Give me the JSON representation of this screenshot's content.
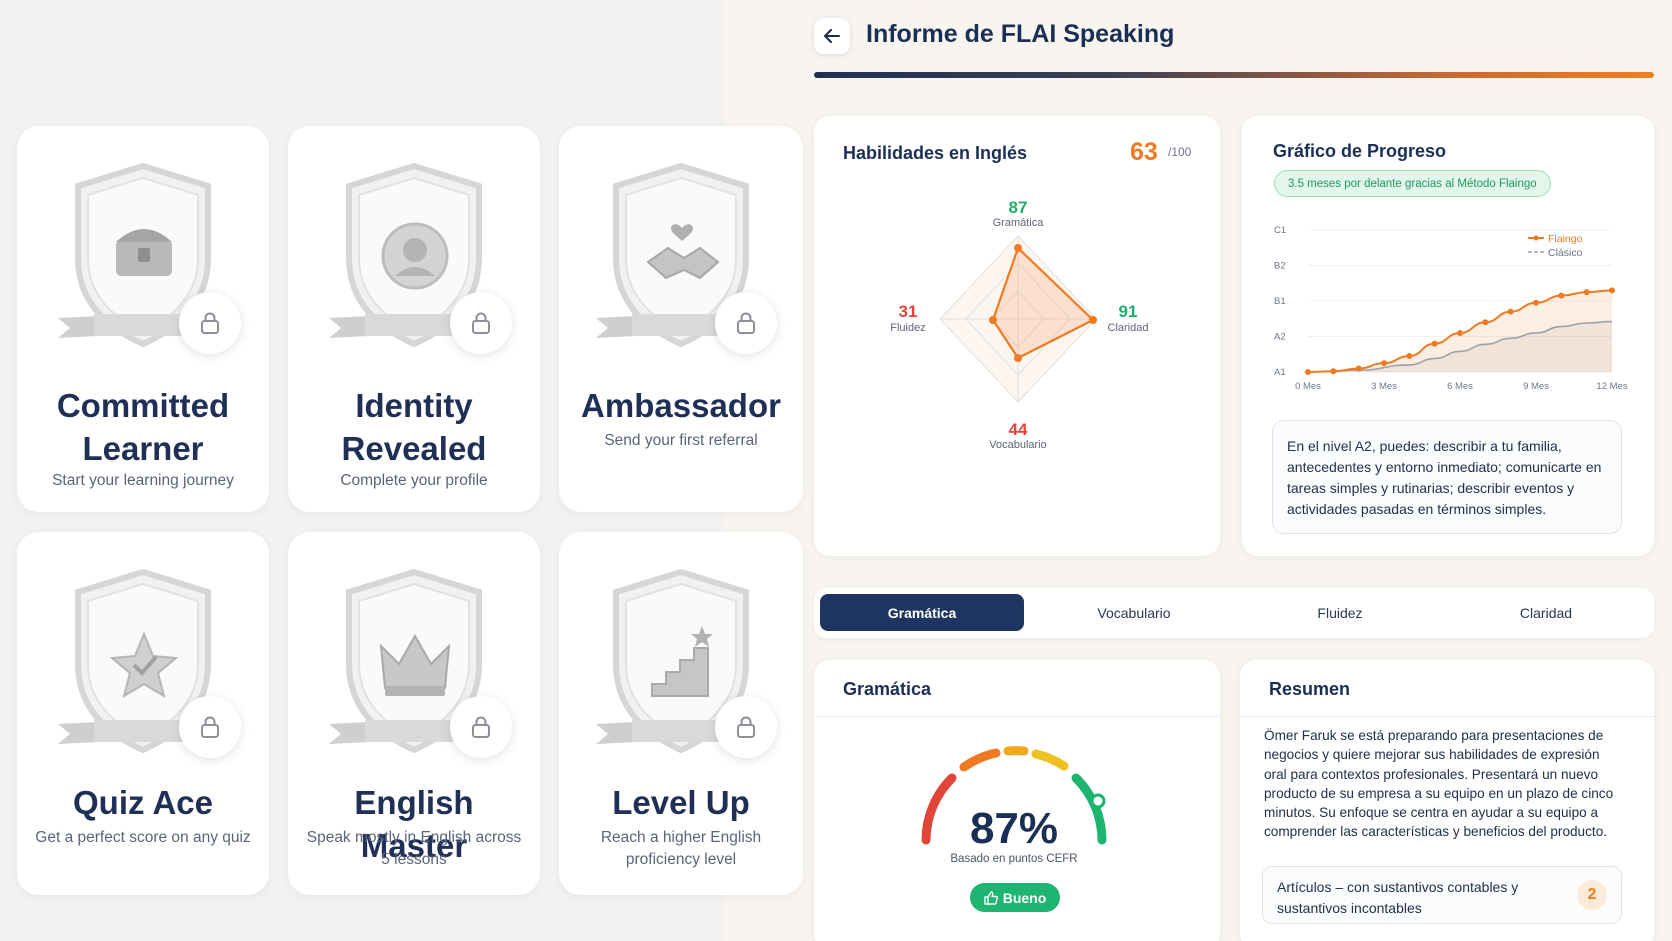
{
  "badges": [
    {
      "title": "Committed Learner",
      "desc": "Start your learning journey",
      "icon": "treasure-chest-icon"
    },
    {
      "title": "Identity Revealed",
      "desc": "Complete your profile",
      "icon": "portrait-medal-icon"
    },
    {
      "title": "Ambassador",
      "desc": "Send your first referral",
      "icon": "handshake-icon"
    },
    {
      "title": "Quiz Ace",
      "desc": "Get a perfect score on any quiz",
      "icon": "star-icon"
    },
    {
      "title": "English Master",
      "desc": "Speak mostly in English across 5 lessons",
      "icon": "crown-icon"
    },
    {
      "title": "Level Up",
      "desc": "Reach a higher English proficiency level",
      "icon": "stairs-icon"
    }
  ],
  "header": {
    "title": "Informe de FLAI Speaking",
    "back_icon": "arrow-left-icon"
  },
  "skills": {
    "title": "Habilidades en Inglés",
    "score": "63",
    "score_max": "/100",
    "radar": {
      "gramatica": {
        "value": "87",
        "label": "Gramática",
        "color": "#1fae6a"
      },
      "claridad": {
        "value": "91",
        "label": "Claridad",
        "color": "#1fae6a"
      },
      "vocabulario": {
        "value": "44",
        "label": "Vocabulario",
        "color": "#e2443a"
      },
      "fluidez": {
        "value": "31",
        "label": "Fluidez",
        "color": "#e2443a"
      }
    }
  },
  "progress": {
    "title": "Gráfico de Progreso",
    "chip": "3.5 meses por delante gracias al Método Flaingo",
    "level_text": "En el nivel A2, puedes: describir a tu familia, antecedentes y entorno inmediato; comunicarte en tareas simples y rutinarias; describir eventos y actividades pasadas en términos simples."
  },
  "chart_data": {
    "type": "line",
    "title": "",
    "y_categories": [
      "A1",
      "A2",
      "B1",
      "B2",
      "C1"
    ],
    "x_ticks": [
      "0 Mes",
      "3 Mes",
      "6 Mes",
      "9 Mes",
      "12 Mes"
    ],
    "xlim": [
      0,
      12
    ],
    "ylim": [
      0,
      4
    ],
    "legend": "top-right",
    "series": [
      {
        "name": "Flaingo",
        "color": "#f07a22",
        "x": [
          0,
          1,
          2,
          3,
          4,
          5,
          6,
          7,
          8,
          9,
          10,
          11,
          12
        ],
        "y": [
          0.0,
          0.02,
          0.1,
          0.25,
          0.45,
          0.8,
          1.1,
          1.4,
          1.7,
          1.95,
          2.15,
          2.25,
          2.3
        ]
      },
      {
        "name": "Clásico",
        "color": "#9aa1ad",
        "x": [
          0,
          2,
          4,
          5,
          6,
          7,
          8,
          9,
          10,
          11,
          12
        ],
        "y": [
          0.0,
          0.05,
          0.2,
          0.38,
          0.58,
          0.78,
          0.95,
          1.1,
          1.28,
          1.38,
          1.42
        ]
      }
    ]
  },
  "tabs": [
    "Gramática",
    "Vocabulario",
    "Fluidez",
    "Claridad"
  ],
  "grammar": {
    "title": "Gramática",
    "percent": "87%",
    "note": "Basado en puntos CEFR",
    "badge": "Bueno",
    "value": 0.87
  },
  "summary": {
    "title": "Resumen",
    "text": "Ömer Faruk se está preparando para presentaciones de negocios y quiere mejorar sus habilidades de expresión oral para contextos profesionales. Presentará un nuevo producto de su empresa a su equipo en un plazo de cinco minutos. Su enfoque se centra en ayudar a su equipo a comprender las características y beneficios del producto.",
    "topic": "Artículos – con sustantivos contables y sustantivos incontables",
    "topic_count": "2"
  },
  "colors": {
    "accent": "#f07a22",
    "navy": "#1d3560",
    "good": "#1db56f",
    "bad": "#e2443a"
  }
}
